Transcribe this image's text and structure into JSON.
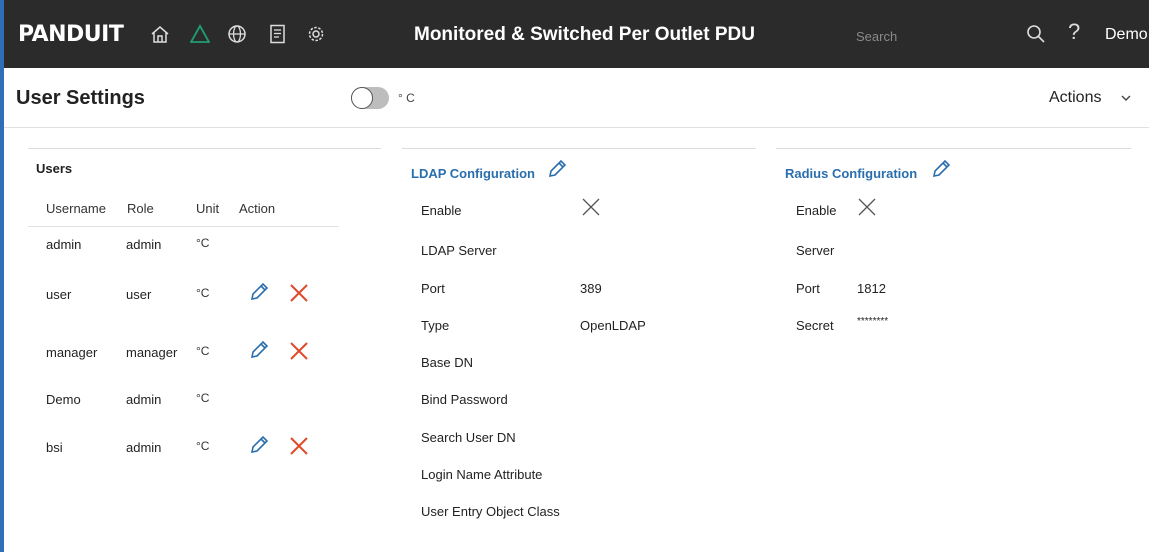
{
  "header": {
    "logo": "PANDUIT",
    "title": "Monitored & Switched Per Outlet PDU",
    "search_placeholder": "Search",
    "help": "?",
    "user": "Demo"
  },
  "colors": {
    "topbar": "#2b2b2b",
    "accent": "#2a6ead",
    "alarm": "#1f9e75",
    "delete": "#e04a2a"
  },
  "page": {
    "title": "User Settings",
    "temp_toggle_label": "° C",
    "actions_label": "Actions"
  },
  "users": {
    "title": "Users",
    "columns": [
      "Username",
      "Role",
      "Unit",
      "Action"
    ],
    "rows": [
      {
        "username": "admin",
        "role": "admin",
        "unit": "°C",
        "editable": false
      },
      {
        "username": "user",
        "role": "user",
        "unit": "°C",
        "editable": true
      },
      {
        "username": "manager",
        "role": "manager",
        "unit": "°C",
        "editable": true
      },
      {
        "username": "Demo",
        "role": "admin",
        "unit": "°C",
        "editable": false
      },
      {
        "username": "bsi",
        "role": "admin",
        "unit": "°C",
        "editable": true
      }
    ]
  },
  "ldap": {
    "title": "LDAP Configuration",
    "fields": [
      {
        "label": "Enable",
        "value": ""
      },
      {
        "label": "LDAP Server",
        "value": ""
      },
      {
        "label": "Port",
        "value": "389"
      },
      {
        "label": "Type",
        "value": "OpenLDAP"
      },
      {
        "label": "Base DN",
        "value": ""
      },
      {
        "label": "Bind Password",
        "value": ""
      },
      {
        "label": "Search User DN",
        "value": ""
      },
      {
        "label": "Login Name Attribute",
        "value": ""
      },
      {
        "label": "User Entry Object Class",
        "value": ""
      }
    ]
  },
  "radius": {
    "title": "Radius Configuration",
    "fields": [
      {
        "label": "Enable",
        "value": ""
      },
      {
        "label": "Server",
        "value": ""
      },
      {
        "label": "Port",
        "value": "1812"
      },
      {
        "label": "Secret",
        "value": "********"
      }
    ]
  }
}
